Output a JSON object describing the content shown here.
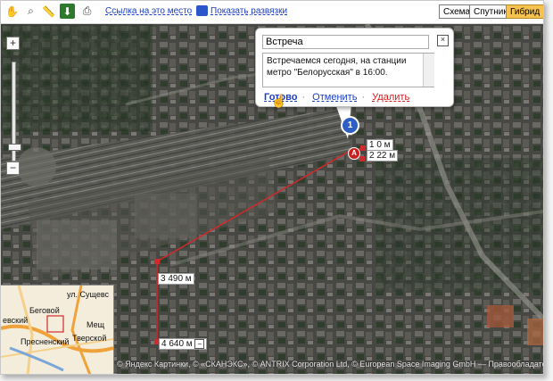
{
  "toolbar": {
    "tools": [
      "hand-icon",
      "magnifier-icon",
      "ruler-icon",
      "pin-icon",
      "print-icon"
    ],
    "link_label": "Ссылка на это место",
    "show_labels_label": "Показать развязки",
    "map_types": [
      "Схема",
      "Спутник",
      "Гибрид"
    ],
    "selected_map_type": "Гибрид"
  },
  "zoom": {
    "plus": "+",
    "minus": "−",
    "level_fraction": 0.88
  },
  "balloon": {
    "title_value": "Встреча",
    "text_value": "Встречаемся сегодня, на станции метро \"Белорусская\" в 16:00.",
    "done_label": "Готово",
    "cancel_label": "Отменить",
    "delete_label": "Удалить",
    "close_glyph": "×",
    "separator": "·"
  },
  "placemark": {
    "number": "1"
  },
  "route": {
    "start_letter": "A",
    "labels": {
      "p0": "0 м",
      "p22": "22 м",
      "p490": "490 м",
      "p640": "640 м",
      "p490_num": "3",
      "p640_num": "4",
      "p22_num": "2",
      "p0_num": "1"
    }
  },
  "minimap": {
    "labels": [
      "ул. Сущевс",
      "Беговой",
      "евский",
      "Мещ",
      "Пресненский",
      "Тверской"
    ]
  },
  "copyright": "© Яндекс Картинки, © «СКАНЭКС», © ANTRIX Corporation Ltd, © European Space Imaging GmbH — Правообладатели",
  "colors": {
    "route": "#d02a2a",
    "accent": "#f5c24f",
    "link": "#1a3dc1",
    "delete": "#d01c1c"
  }
}
